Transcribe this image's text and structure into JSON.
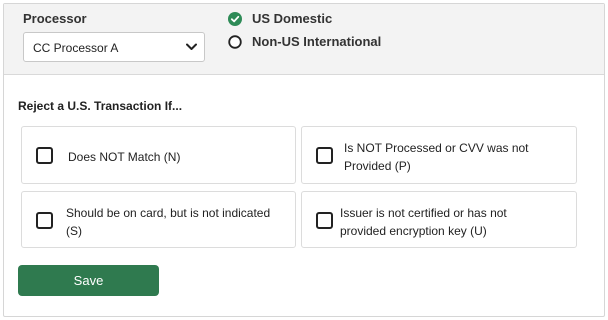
{
  "processor": {
    "label": "Processor",
    "selected": "CC Processor A"
  },
  "region": {
    "options": [
      {
        "label": "US Domestic",
        "selected": true
      },
      {
        "label": "Non-US International",
        "selected": false
      }
    ]
  },
  "reject": {
    "title": "Reject a U.S. Transaction If...",
    "options": [
      {
        "line1": "Does NOT Match (N)",
        "line2": "",
        "checked": false
      },
      {
        "line1": "Is NOT Processed or CVV was not",
        "line2": "Provided (P)",
        "checked": false
      },
      {
        "line1": "Should be on card, but is not indicated",
        "line2": "(S)",
        "checked": false
      },
      {
        "line1": "Issuer is not certified or has not",
        "line2": "provided encryption key (U)",
        "checked": false
      }
    ]
  },
  "actions": {
    "save_label": "Save"
  },
  "colors": {
    "accent_green": "#2f7a4f",
    "radio_selected": "#2e8b57"
  },
  "icons": {
    "selected_radio": "check-circle-icon",
    "unselected_radio": "radio-empty-icon",
    "dropdown": "chevron-down-icon"
  }
}
